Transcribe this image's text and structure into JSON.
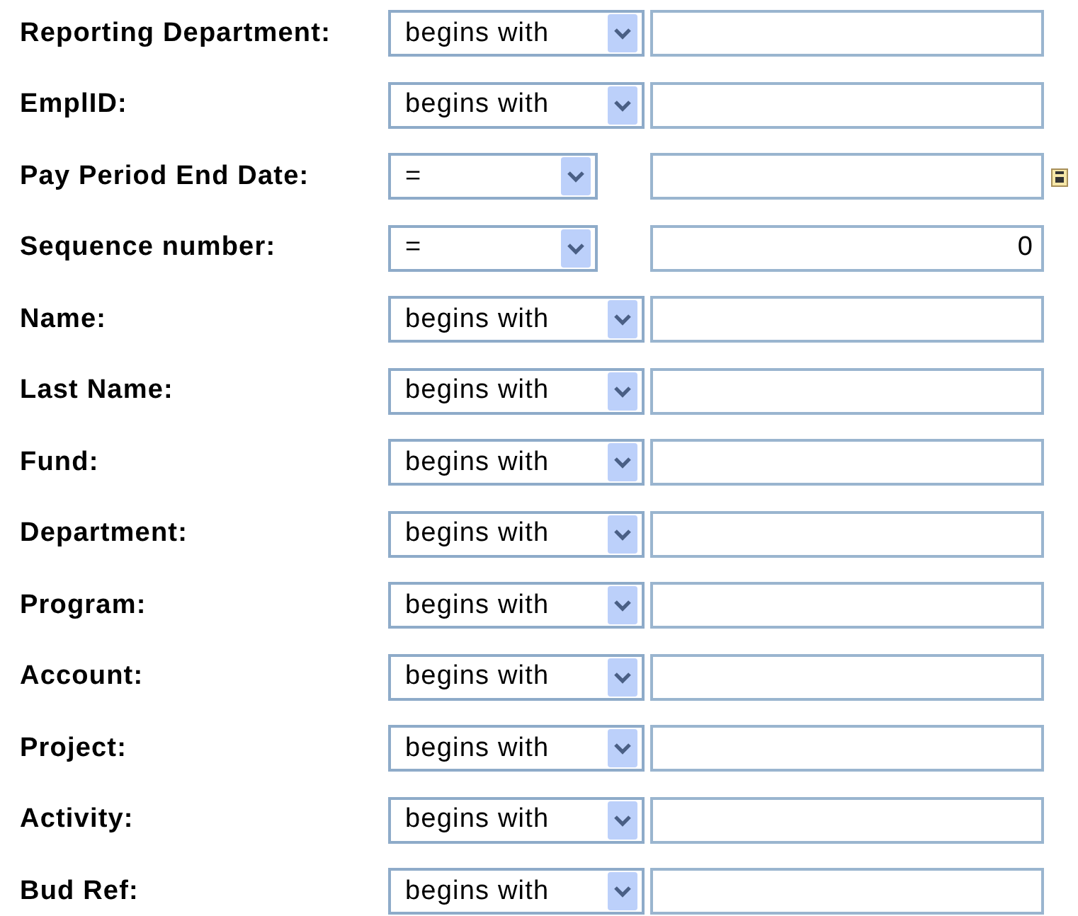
{
  "fields": [
    {
      "label": "Reporting Department:",
      "operator": "begins with",
      "kind": "text"
    },
    {
      "label": "EmplID:",
      "operator": "begins with",
      "kind": "text"
    },
    {
      "label": "Pay Period End Date:",
      "operator": "=",
      "kind": "date"
    },
    {
      "label": "Sequence number:",
      "operator": "=",
      "kind": "number",
      "value": "0"
    },
    {
      "label": "Name:",
      "operator": "begins with",
      "kind": "text"
    },
    {
      "label": "Last Name:",
      "operator": "begins with",
      "kind": "text"
    },
    {
      "label": "Fund:",
      "operator": "begins with",
      "kind": "text"
    },
    {
      "label": "Department:",
      "operator": "begins with",
      "kind": "text"
    },
    {
      "label": "Program:",
      "operator": "begins with",
      "kind": "text"
    },
    {
      "label": "Account:",
      "operator": "begins with",
      "kind": "text"
    },
    {
      "label": "Project:",
      "operator": "begins with",
      "kind": "text"
    },
    {
      "label": "Activity:",
      "operator": "begins with",
      "kind": "text"
    },
    {
      "label": "Bud Ref:",
      "operator": "begins with",
      "kind": "text"
    }
  ]
}
